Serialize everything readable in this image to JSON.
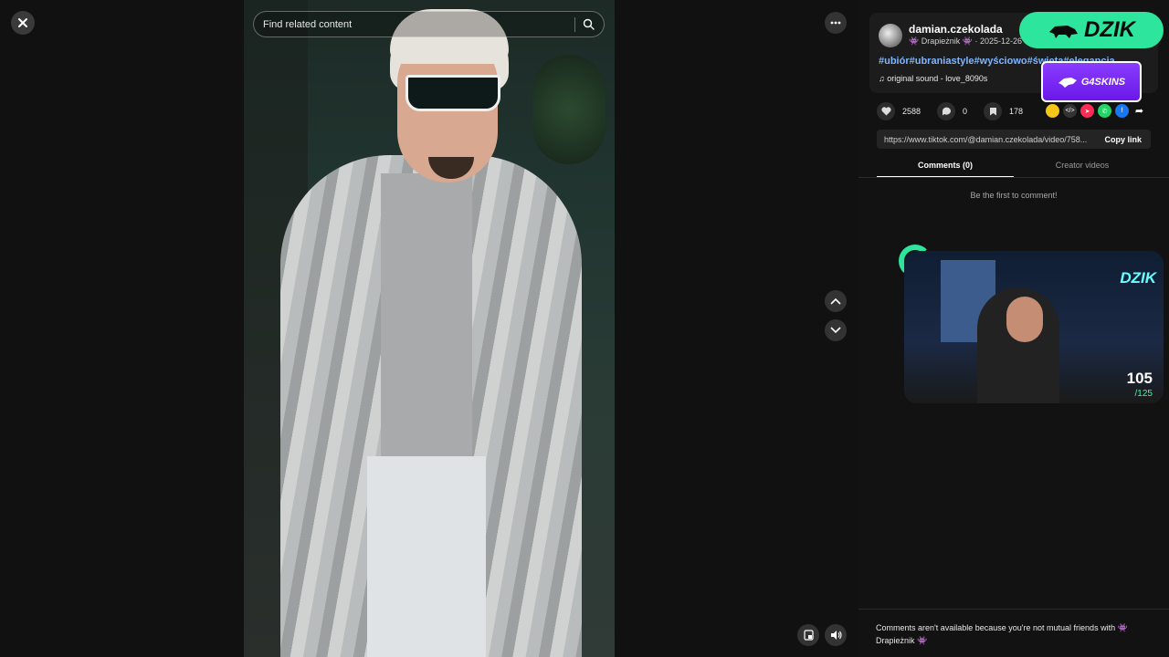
{
  "search": {
    "placeholder": "Find related content"
  },
  "post": {
    "username": "damian.czekolada",
    "display_name": "Drapieżnik",
    "badge_icon": "👾",
    "date": "2025-12-26",
    "hashtags": "#ubiór#ubraniastyle#wyściowo#święta#elegancja",
    "sound": "original sound - love_8090s",
    "likes": "2588",
    "comments": "0",
    "saves": "178",
    "url": "https://www.tiktok.com/@damian.czekolada/video/758...",
    "copy_link_label": "Copy link"
  },
  "tabs": [
    {
      "label": "Comments (0)",
      "active": true
    },
    {
      "label": "Creator videos",
      "active": false
    }
  ],
  "comments": {
    "empty": "Be the first to comment!",
    "notice_prefix": "Comments aren't available because you're not mutual friends with",
    "notice_name": "Drapieżnik"
  },
  "overlay": {
    "brand_logo": "DZIK",
    "sponsor_logo": "G4SKINS",
    "stream_neon": "DZIK",
    "stream_count": "105",
    "stream_total": "/125"
  },
  "colors": {
    "accent": "#2ee59d",
    "link": "#7fb6ff",
    "sponsor": "#7a2cf5"
  }
}
